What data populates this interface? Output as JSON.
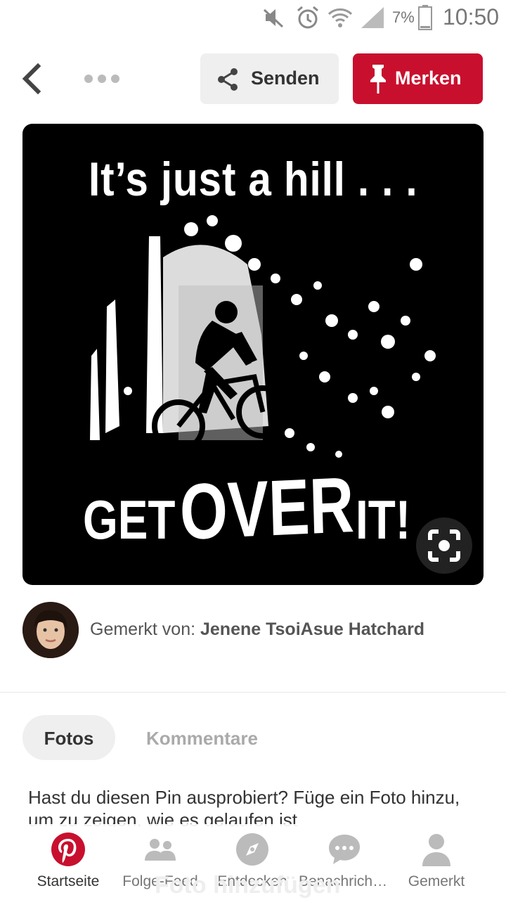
{
  "status_bar": {
    "icons": [
      "mute-icon",
      "alarm-icon",
      "wifi-icon",
      "signal-icon",
      "battery-icon"
    ],
    "battery_percent": "7%",
    "time": "10:50"
  },
  "header": {
    "back_icon": "back-arrow-icon",
    "more_icon": "more-dots-icon",
    "send_label": "Senden",
    "save_label": "Merken"
  },
  "pin": {
    "image_text_top": "It’s just a hill . . .",
    "image_text_get": "GET",
    "image_text_over": "OVER",
    "image_text_it": "IT!",
    "lens_icon": "visual-search-icon"
  },
  "saver": {
    "prefix": "Gemerkt von: ",
    "name": "Jenene TsoiAsue Hatchard"
  },
  "tabs": {
    "photos": "Fotos",
    "comments": "Kommentare"
  },
  "prompt_text": "Hast du diesen Pin ausprobiert? Füge ein Foto hinzu, um zu zeigen, wie es gelaufen ist",
  "ghost_button": "Foto hinzufügen",
  "colors": {
    "brand_red": "#c8102e",
    "muted_gray": "#aaaaaa",
    "button_gray": "#efefef"
  },
  "bottom_nav": {
    "items": [
      {
        "label": "Startseite",
        "icon": "pinterest-logo-icon",
        "active": true
      },
      {
        "label": "Folge-Feed",
        "icon": "people-icon",
        "active": false
      },
      {
        "label": "Entdecken",
        "icon": "compass-icon",
        "active": false
      },
      {
        "label": "Benachrichtigungen",
        "icon": "chat-bubble-icon",
        "active": false
      },
      {
        "label": "Gemerkt",
        "icon": "profile-icon",
        "active": false
      }
    ]
  }
}
